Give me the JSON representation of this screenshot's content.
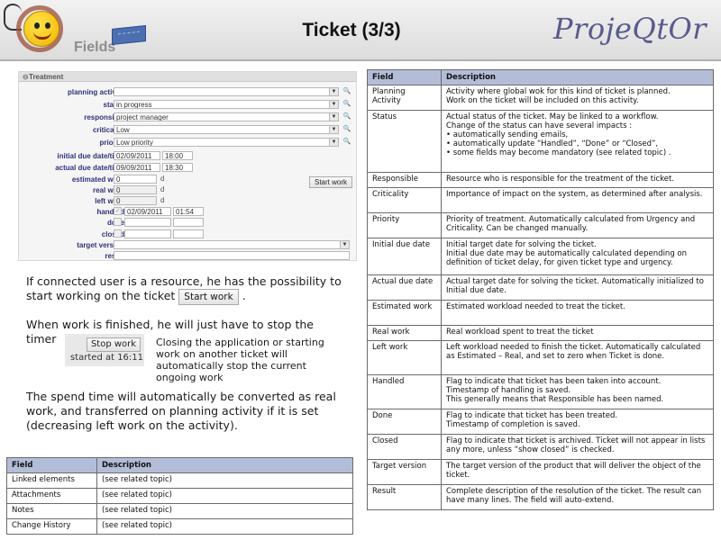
{
  "header": {
    "logo_text": "Fields",
    "title": "Ticket (3/3)",
    "brand": "ProjeQtOr"
  },
  "treatment": {
    "section_title": "Treatment",
    "rows": [
      {
        "label": "planning activity :",
        "value": ""
      },
      {
        "label": "status :",
        "value": "in progress"
      },
      {
        "label": "responsible :",
        "value": "project manager"
      },
      {
        "label": "criticality :",
        "value": "Low"
      },
      {
        "label": "priority :",
        "value": "Low priority"
      },
      {
        "label": "initial due date/time :",
        "date": "02/09/2011",
        "time": "18:00"
      },
      {
        "label": "actual due date/time :",
        "date": "09/09/2011",
        "time": "18:30"
      },
      {
        "label": "estimated work :",
        "value": "0",
        "unit": "d"
      },
      {
        "label": "real work :",
        "value": "0",
        "unit": "d"
      },
      {
        "label": "left work :",
        "value": "0",
        "unit": "d"
      },
      {
        "label": "handled :",
        "date": "02/09/2011",
        "time": "01:54"
      },
      {
        "label": "done :"
      },
      {
        "label": "closed :"
      },
      {
        "label": "target version :",
        "value": ""
      },
      {
        "label": "result :",
        "value": ""
      }
    ],
    "start_work_label": "Start work"
  },
  "text": {
    "para1": "If connected user is a resource, he has the possibility to start working on the ticket",
    "para1_button": "Start work",
    "para1_end": ".",
    "para2": "When work is finished, he will just have to stop the timer",
    "stop_button": "Stop work",
    "started_at": "started at 16:11",
    "para2_side": "Closing the application or starting work on another ticket will automatically stop the current ongoing work",
    "para3": "The spend time will automatically be converted as real work, and transferred on planning activity if it is set (decreasing left work on the activity)."
  },
  "bottom_table": {
    "headers": [
      "Field",
      "Description"
    ],
    "rows": [
      [
        "Linked elements",
        "(see related topic)"
      ],
      [
        "Attachments",
        "(see related topic)"
      ],
      [
        "Notes",
        "(see related topic)"
      ],
      [
        "Change History",
        "(see related topic)"
      ]
    ]
  },
  "main_table": {
    "headers": [
      "Field",
      "Description"
    ],
    "rows": [
      {
        "field": "Planning Activity",
        "desc": [
          "Activity where global wok for this kind of ticket is planned.",
          "Work on the ticket will be included on this activity."
        ]
      },
      {
        "field": "Status",
        "desc": [
          "Actual status of the ticket. May be linked to a workflow.",
          "Change of the status can have several impacts :"
        ],
        "bullets": [
          "automatically sending emails,",
          "automatically update “Handled”, “Done” or “Closed”,",
          "some fields may become mandatory (see related topic) ."
        ]
      },
      {
        "field": "Responsible",
        "desc": [
          "Resource who is responsible for the treatment of the ticket."
        ]
      },
      {
        "field": "Criticality",
        "desc": [
          "Importance of impact on the system, as determined after analysis."
        ]
      },
      {
        "field": "Priority",
        "desc": [
          "Priority of treatment. Automatically calculated from Urgency and Criticality. Can be changed manually."
        ]
      },
      {
        "field": "Initial due date",
        "desc": [
          "Initial target date for solving the ticket.",
          "Initial due date may be automatically calculated depending on definition of ticket delay, for given ticket type and urgency."
        ]
      },
      {
        "field": "Actual due date",
        "desc": [
          "Actual target date for solving the ticket. Automatically initialized to Initial due date."
        ]
      },
      {
        "field": "Estimated work",
        "desc": [
          "Estimated workload needed to treat the ticket."
        ]
      },
      {
        "field": "Real work",
        "desc": [
          "Real workload spent to treat the ticket"
        ]
      },
      {
        "field": "Left work",
        "desc": [
          "Left workload needed to finish the ticket. Automatically calculated as Estimated – Real, and set to zero when Ticket is done."
        ]
      },
      {
        "field": "Handled",
        "desc": [
          "Flag to indicate that ticket has been taken into account.",
          "Timestamp of handling is saved.",
          "This generally means that Responsible has been named."
        ]
      },
      {
        "field": "Done",
        "desc": [
          "Flag to indicate that ticket has been treated.",
          "Timestamp of completion is saved."
        ]
      },
      {
        "field": "Closed",
        "desc": [
          "Flag to indicate that ticket is archived. Ticket will not appear in lists any more, unless “show closed” is checked."
        ]
      },
      {
        "field": "Target version",
        "desc": [
          "The target version of the product that will deliver the object of the ticket."
        ]
      },
      {
        "field": "Result",
        "desc": [
          "Complete description of the resolution of the ticket. The result can have many lines. The field will auto-extend."
        ]
      }
    ]
  },
  "colors": {
    "table_header": "#b4bdd8",
    "label_blue": "#31317c",
    "brand": "#5a5a8c"
  }
}
